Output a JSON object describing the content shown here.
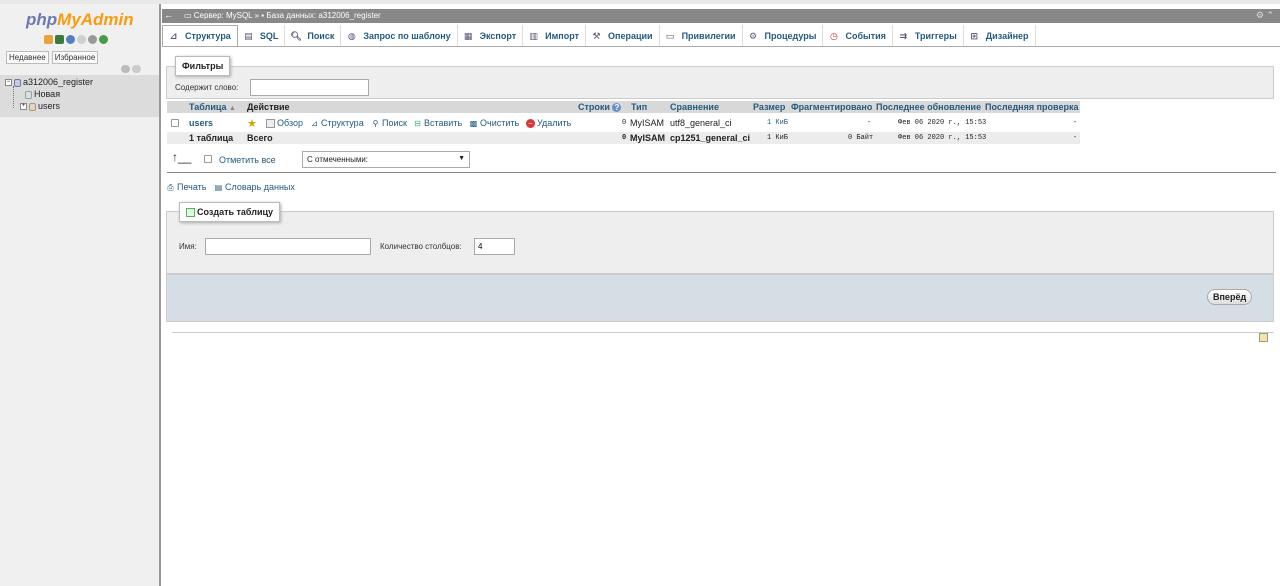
{
  "logo": {
    "php": "php",
    "my": "MyAdmin"
  },
  "left_panel": {
    "links": [
      "Недавнее",
      "Избранное"
    ],
    "db_name": "a312006_register",
    "tree_new": "Новая",
    "tree_table": "users"
  },
  "breadcrumb": {
    "server": "Сервер: MySQL",
    "sep": "»",
    "database": "База данных: a312006_register"
  },
  "tabs": [
    {
      "label": "Структура",
      "icon": "structure-icon"
    },
    {
      "label": "SQL",
      "icon": "sql-icon"
    },
    {
      "label": "Поиск",
      "icon": "search-icon"
    },
    {
      "label": "Запрос по шаблону",
      "icon": "query-icon"
    },
    {
      "label": "Экспорт",
      "icon": "export-icon"
    },
    {
      "label": "Импорт",
      "icon": "import-icon"
    },
    {
      "label": "Операции",
      "icon": "wrench-icon"
    },
    {
      "label": "Привилегии",
      "icon": "privileges-icon"
    },
    {
      "label": "Процедуры",
      "icon": "routines-icon"
    },
    {
      "label": "События",
      "icon": "events-icon"
    },
    {
      "label": "Триггеры",
      "icon": "triggers-icon"
    },
    {
      "label": "Дизайнер",
      "icon": "designer-icon"
    }
  ],
  "filters": {
    "legend": "Фильтры",
    "label": "Содержит слово:",
    "value": ""
  },
  "table": {
    "headers": {
      "table": "Таблица",
      "action": "Действие",
      "rows": "Строки",
      "type": "Тип",
      "collation": "Сравнение",
      "size": "Размер",
      "overhead": "Фрагментировано",
      "last_update": "Последнее обновление",
      "last_check": "Последняя проверка"
    },
    "row": {
      "name": "users",
      "browse": "Обзор",
      "structure": "Структура",
      "search": "Поиск",
      "insert": "Вставить",
      "empty": "Очистить",
      "drop": "Удалить",
      "rows": "0",
      "type": "MyISAM",
      "collation": "utf8_general_ci",
      "size": "1 КиБ",
      "overhead": "-",
      "last_update": "Фев 06 2020 г., 15:53",
      "last_check": "-"
    },
    "total": {
      "name": "1 таблица",
      "label": "Всего",
      "rows": "0",
      "type": "MyISAM",
      "collation": "cp1251_general_ci",
      "size": "1 КиБ",
      "overhead": "0 Байт",
      "last_update": "Фев 06 2020 г., 15:53",
      "last_check": "-"
    }
  },
  "bulk": {
    "check_all": "Отметить все",
    "with_selected": "С отмеченными:"
  },
  "links": {
    "print": "Печать",
    "dictionary": "Словарь данных"
  },
  "create": {
    "legend": "Создать таблицу",
    "name_label": "Имя:",
    "name_value": "",
    "cols_label": "Количество столбцов:",
    "cols_value": "4",
    "go": "Вперёд"
  }
}
